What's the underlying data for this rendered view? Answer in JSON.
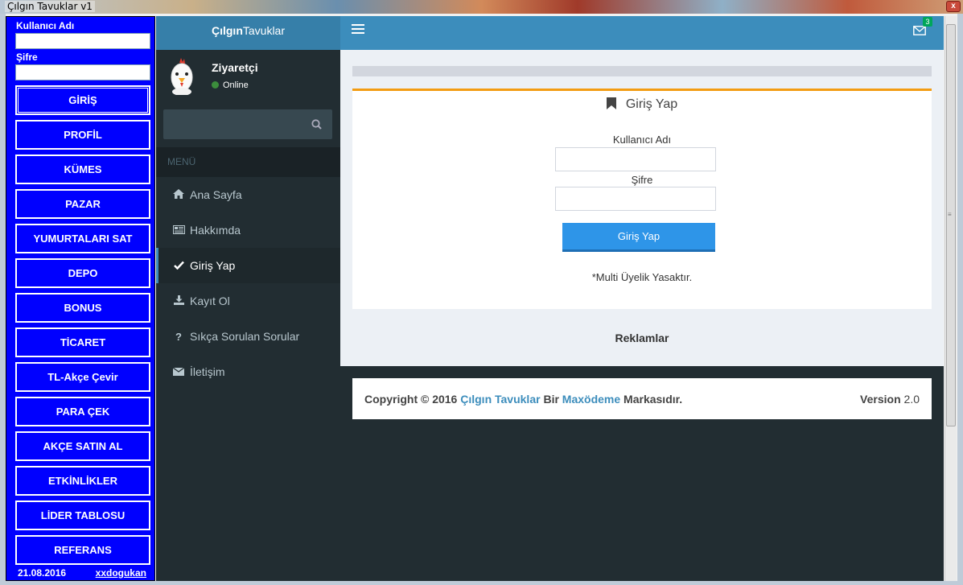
{
  "window": {
    "title": "Çılgın Tavuklar v1",
    "close_glyph": "x"
  },
  "left_panel": {
    "username_label": "Kullanıcı Adı",
    "password_label": "Şifre",
    "buttons": [
      "GİRİŞ",
      "PROFİL",
      "KÜMES",
      "PAZAR",
      "YUMURTALARI SAT",
      "DEPO",
      "BONUS",
      "TİCARET",
      "TL-Akçe Çevir",
      "PARA ÇEK",
      "AKÇE SATIN AL",
      "ETKİNLİKLER",
      "LİDER TABLOSU",
      "REFERANS"
    ],
    "date": "21.08.2016",
    "author_link": "xxdogukan"
  },
  "sidebar": {
    "logo_bold": "Çılgın",
    "logo_rest": "Tavuklar",
    "username": "Ziyaretçi",
    "status": "Online",
    "menu_header": "MENÜ",
    "items": [
      {
        "label": "Ana Sayfa",
        "icon": "home-icon"
      },
      {
        "label": "Hakkımda",
        "icon": "newspaper-icon"
      },
      {
        "label": "Giriş Yap",
        "icon": "check-icon"
      },
      {
        "label": "Kayıt Ol",
        "icon": "download-icon"
      },
      {
        "label": "Sıkça Sorulan Sorular",
        "icon": "question-icon"
      },
      {
        "label": "İletişim",
        "icon": "envelope-icon"
      }
    ]
  },
  "navbar": {
    "mail_count": "3"
  },
  "login_box": {
    "title": "Giriş Yap",
    "username_label": "Kullanıcı Adı",
    "password_label": "Şifre",
    "submit_label": "Giriş Yap",
    "note": "*Multi Üyelik Yasaktır."
  },
  "ads_label": "Reklamlar",
  "footer": {
    "copyright": "Copyright © 2016",
    "brand": "Çılgın Tavuklar",
    "bir": "Bir",
    "company": "Maxödeme",
    "suffix": "Markasıdır.",
    "version_label": "Version",
    "version_value": "2.0"
  },
  "colors": {
    "left_panel_bg": "#0000ff",
    "sidebar_bg": "#222d32",
    "navbar_bg": "#3c8dbc",
    "logo_bg": "#367fa9",
    "box_accent": "#f39c12",
    "submit_bg": "#2e95e8"
  }
}
